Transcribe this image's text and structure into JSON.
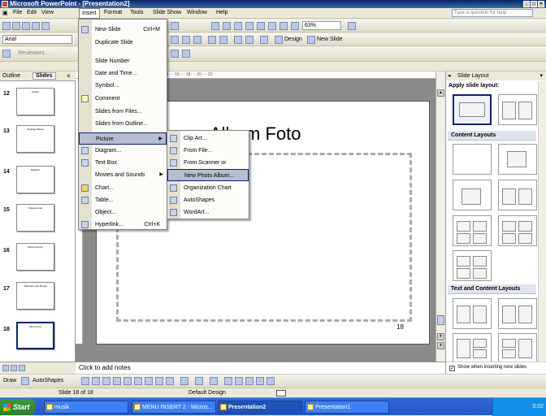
{
  "window": {
    "title": "Microsoft PowerPoint - [Presentation2]"
  },
  "menubar": {
    "items": [
      "File",
      "Edit",
      "View",
      "Insert",
      "Format",
      "Tools",
      "Slide Show",
      "Window",
      "Help"
    ],
    "ask_placeholder": "Type a question for help"
  },
  "toolbar": {
    "font_name": "Arial",
    "zoom": "63%",
    "reviewers": "Reviewers...",
    "design": "Design",
    "new_slide": "New Slide"
  },
  "insert_menu": {
    "items": [
      {
        "label": "New Slide",
        "shortcut": "Ctrl+M"
      },
      {
        "label": "Duplicate Slide",
        "shortcut": ""
      },
      {
        "label": "Slide Number",
        "shortcut": ""
      },
      {
        "label": "Date and Time...",
        "shortcut": ""
      },
      {
        "label": "Symbol...",
        "shortcut": ""
      },
      {
        "label": "Comment",
        "shortcut": ""
      },
      {
        "label": "Slides from Files...",
        "shortcut": ""
      },
      {
        "label": "Slides from Outline...",
        "shortcut": ""
      },
      {
        "label": "Picture",
        "shortcut": ""
      },
      {
        "label": "Diagram...",
        "shortcut": ""
      },
      {
        "label": "Text Box",
        "shortcut": ""
      },
      {
        "label": "Movies and Sounds",
        "shortcut": ""
      },
      {
        "label": "Chart...",
        "shortcut": ""
      },
      {
        "label": "Table...",
        "shortcut": ""
      },
      {
        "label": "Object...",
        "shortcut": ""
      },
      {
        "label": "Hyperlink...",
        "shortcut": "Ctrl+K"
      }
    ]
  },
  "picture_submenu": {
    "items": [
      "Clip Art...",
      "From File...",
      "From Scanner or Camera...",
      "New Photo Album...",
      "Organization Chart",
      "AutoShapes",
      "WordArt..."
    ]
  },
  "outline_pane": {
    "tabs": [
      "Outline",
      "Slides"
    ],
    "slides": [
      {
        "num": "12",
        "title": "Relasi"
      },
      {
        "num": "13",
        "title": "Segitiga Warna"
      },
      {
        "num": "14",
        "title": "Diagram"
      },
      {
        "num": "15",
        "title": "Sayap Emas"
      },
      {
        "num": "16",
        "title": "Kelinci Kuning"
      },
      {
        "num": "17",
        "title": "Tanaman Lain Bunga"
      },
      {
        "num": "18",
        "title": "Album Foto"
      }
    ]
  },
  "slide": {
    "title": "Album Foto",
    "number": "18"
  },
  "notes": {
    "placeholder": "Click to add notes"
  },
  "task_pane": {
    "title": "Slide Layout",
    "apply_label": "Apply slide layout:",
    "content_section": "Content Layouts",
    "text_content_section": "Text and Content Layouts",
    "show_when_inserting": "Show when inserting new slides"
  },
  "drawbar": {
    "draw": "Draw",
    "autoshapes": "AutoShapes"
  },
  "status": {
    "slide_of": "Slide 18 of 18",
    "design": "Default Design"
  },
  "taskbar": {
    "start": "Start",
    "buttons": [
      {
        "label": "musik",
        "active": false
      },
      {
        "label": "MENU INSERT 2 - Micros...",
        "active": false
      },
      {
        "label": "Presentation2",
        "active": true
      },
      {
        "label": "Presentation1",
        "active": false
      }
    ],
    "clock": "0:02"
  },
  "colors": {
    "titlebar": "#0a246a",
    "taskbar": "#2457c5",
    "start": "#2d7e2d",
    "highlight": "#b6bdd2"
  }
}
